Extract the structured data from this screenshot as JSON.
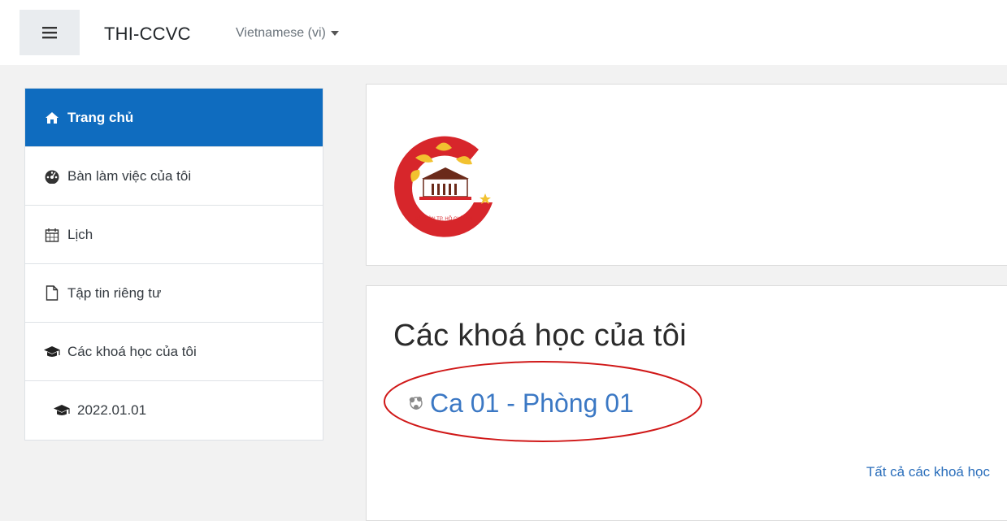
{
  "navbar": {
    "menu_icon": "hamburger-icon",
    "site_name": "THI-CCVC",
    "language": "Vietnamese (vi)"
  },
  "nav": {
    "items": [
      {
        "label": "Trang chủ",
        "icon": "home-icon",
        "active": true
      },
      {
        "label": "Bàn làm việc của tôi",
        "icon": "dashboard-icon",
        "active": false
      },
      {
        "label": "Lịch",
        "icon": "calendar-icon",
        "active": false
      },
      {
        "label": "Tập tin riêng tư",
        "icon": "file-icon",
        "active": false
      },
      {
        "label": "Các khoá học của tôi",
        "icon": "graduation-cap-icon",
        "active": false
      },
      {
        "label": "2022.01.01",
        "icon": "graduation-cap-icon",
        "active": false
      }
    ]
  },
  "logo": {
    "text": "SÀI GÒN TP. HỒ CHÍ MINH",
    "colors": {
      "red": "#d7262b",
      "yellow": "#f2c230",
      "brown": "#6b2a1a"
    }
  },
  "courses": {
    "title": "Các khoá học của tôi",
    "items": [
      {
        "name": "Ca 01 - Phòng 01",
        "icon": "course-icon"
      }
    ],
    "all_link": "Tất cả các khoá học"
  },
  "annotation_color": "#d01818",
  "accent": "#0f6cbf"
}
